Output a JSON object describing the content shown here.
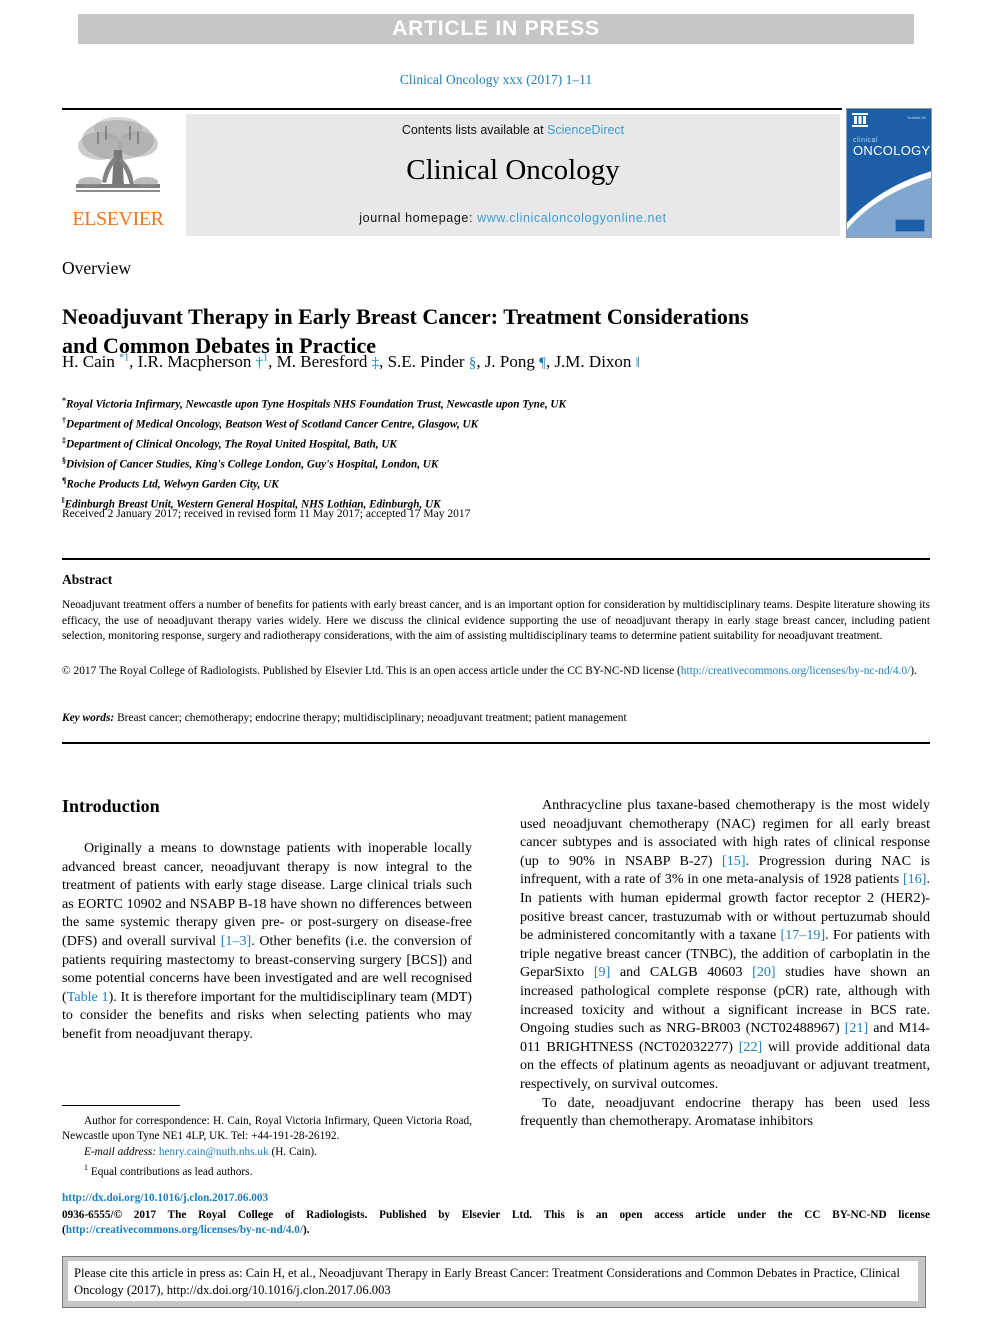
{
  "banner": {
    "text": "ARTICLE IN PRESS"
  },
  "journal_ref": "Clinical Oncology xxx (2017) 1–11",
  "masthead": {
    "contents_prefix": "Contents lists available at ",
    "sciencedirect": "ScienceDirect",
    "journal_title": "Clinical Oncology",
    "homepage_prefix": "journal homepage: ",
    "homepage_url": "www.clinicaloncologyonline.net",
    "elsevier_wordmark": "ELSEVIER",
    "cover": {
      "small_title": "clinical",
      "big_title": "ONCOLOGY",
      "corner_text": "Volume 00"
    }
  },
  "article": {
    "kind": "Overview",
    "title": "Neoadjuvant Therapy in Early Breast Cancer: Treatment Considerations and Common Debates in Practice",
    "authors_html": "H. Cain <sup>*1</sup>, I.R. Macpherson <span class=\"sym\">†</span><sup>1</sup>, M. Beresford <span class=\"sym\">‡</span>, S.E. Pinder <span class=\"sym\">§</span>, J. Pong <span class=\"sym\">¶</span>, J.M. Dixon <span class=\"sym\">‖</span>",
    "affiliations": [
      {
        "mark": "*",
        "text": "Royal Victoria Infirmary, Newcastle upon Tyne Hospitals NHS Foundation Trust, Newcastle upon Tyne, UK"
      },
      {
        "mark": "†",
        "text": "Department of Medical Oncology, Beatson West of Scotland Cancer Centre, Glasgow, UK"
      },
      {
        "mark": "‡",
        "text": "Department of Clinical Oncology, The Royal United Hospital, Bath, UK"
      },
      {
        "mark": "§",
        "text": "Division of Cancer Studies, King's College London, Guy's Hospital, London, UK"
      },
      {
        "mark": "¶",
        "text": "Roche Products Ltd, Welwyn Garden City, UK"
      },
      {
        "mark": "‖",
        "text": "Edinburgh Breast Unit, Western General Hospital, NHS Lothian, Edinburgh, UK"
      }
    ],
    "received": "Received 2 January 2017; received in revised form 11 May 2017; accepted 17 May 2017"
  },
  "abstract": {
    "heading": "Abstract",
    "body": "Neoadjuvant treatment offers a number of benefits for patients with early breast cancer, and is an important option for consideration by multidisciplinary teams. Despite literature showing its efficacy, the use of neoadjuvant therapy varies widely. Here we discuss the clinical evidence supporting the use of neoadjuvant therapy in early stage breast cancer, including patient selection, monitoring response, surgery and radiotherapy considerations, with the aim of assisting multidisciplinary teams to determine patient suitability for neoadjuvant treatment.",
    "copyright_pre": "© 2017 The Royal College of Radiologists. Published by Elsevier Ltd. This is an open access article under the CC BY-NC-ND license (",
    "copyright_link": "http://creativecommons.org/licenses/by-nc-nd/4.0/",
    "copyright_post": ").",
    "keywords_label": "Key words:",
    "keywords": " Breast cancer; chemotherapy; endocrine therapy; multidisciplinary; neoadjuvant treatment; patient management"
  },
  "body": {
    "left": {
      "heading": "Introduction",
      "paragraph1_pre": "Originally a means to downstage patients with inoperable locally advanced breast cancer, neoadjuvant therapy is now integral to the treatment of patients with early stage disease. Large clinical trials such as EORTC 10902 and NSABP B-18 have shown no differences between the same systemic therapy given pre- or post-surgery on disease-free (DFS) and overall survival ",
      "ref_1_3": "[1–3]",
      "paragraph1_mid": ". Other benefits (i.e. the conversion of patients requiring mastectomy to breast-conserving surgery [BCS]) and some potential concerns have been investigated and are well recognised (",
      "table_link": "Table 1",
      "paragraph1_post": "). It is therefore important for the multidisciplinary team (MDT) to consider the benefits and risks when selecting patients who may benefit from neoadjuvant therapy."
    },
    "right": {
      "p1_a": "Anthracycline plus taxane-based chemotherapy is the most widely used neoadjuvant chemotherapy (NAC) regimen for all early breast cancer subtypes and is associated with high rates of clinical response (up to 90% in NSABP B-27) ",
      "ref_15": "[15]",
      "p1_b": ". Progression during NAC is infrequent, with a rate of 3% in one meta-analysis of 1928 patients ",
      "ref_16": "[16]",
      "p1_c": ". In patients with human epidermal growth factor receptor 2 (HER2)-positive breast cancer, trastuzumab with or without pertuzumab should be administered concomitantly with a taxane ",
      "ref_17_19": "[17–19]",
      "p1_d": ". For patients with triple negative breast cancer (TNBC), the addition of carboplatin in the GeparSixto ",
      "ref_9": "[9]",
      "p1_e": " and CALGB 40603 ",
      "ref_20": "[20]",
      "p1_f": " studies have shown an increased pathological complete response (pCR) rate, although with increased toxicity and without a significant increase in BCS rate. Ongoing studies such as NRG-BR003 (NCT02488967) ",
      "ref_21": "[21]",
      "p1_g": " and M14-011 BRIGHTNESS (NCT02032277) ",
      "ref_22": "[22]",
      "p1_h": " will provide additional data on the effects of platinum agents as neoadjuvant or adjuvant treatment, respectively, on survival outcomes.",
      "p2": "To date, neoadjuvant endocrine therapy has been used less frequently than chemotherapy. Aromatase inhibitors"
    }
  },
  "footnote": {
    "correspondence": "Author for correspondence: H. Cain, Royal Victoria Infirmary, Queen Victoria Road, Newcastle upon Tyne NE1 4LP, UK. Tel: +44-191-28-26192.",
    "email_label": "E-mail address:",
    "email": "henry.cain@nuth.nhs.uk",
    "email_suffix": " (H. Cain).",
    "equal_marker": "1",
    "equal_contrib": "Equal contributions as lead authors."
  },
  "page_footer": {
    "doi": "http://dx.doi.org/10.1016/j.clon.2017.06.003",
    "issn_pre": "0936-6555/© 2017 The Royal College of Radiologists. Published by Elsevier Ltd. This is an open access article under the CC BY-NC-ND license (",
    "issn_link": "http://creativecommons.org/licenses/by-nc-nd/4.0/",
    "issn_post": ").",
    "citation": "Please cite this article in press as: Cain H, et al., Neoadjuvant Therapy in Early Breast Cancer: Treatment Considerations and Common Debates in Practice, Clinical Oncology (2017), http://dx.doi.org/10.1016/j.clon.2017.06.003"
  },
  "colors": {
    "link_blue": "#1a7ebc",
    "banner_gray": "#c6c6c6",
    "masthead_gray": "#e8e8e8",
    "elsevier_orange": "#e87722",
    "cover_blue": "#1c5fa8"
  }
}
